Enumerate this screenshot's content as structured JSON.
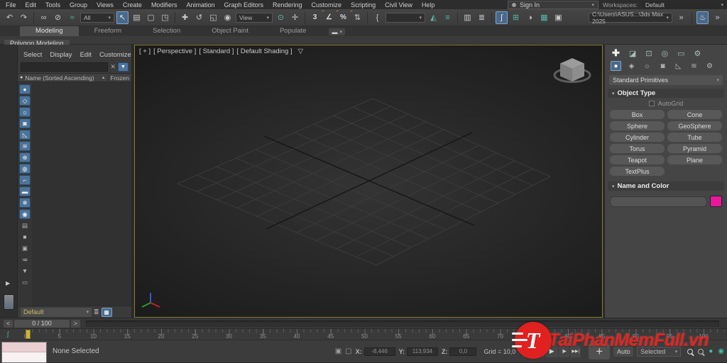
{
  "menubar": {
    "items": [
      "File",
      "Edit",
      "Tools",
      "Group",
      "Views",
      "Create",
      "Modifiers",
      "Animation",
      "Graph Editors",
      "Rendering",
      "Customize",
      "Scripting",
      "Civil View",
      "Help"
    ],
    "sign_in": "Sign In",
    "workspaces_label": "Workspaces:",
    "workspace_value": "Default"
  },
  "toolbar": {
    "selection_filter": "All",
    "coord_system": "View",
    "project_path": "C:\\Users\\ASUS...\\3ds Max 2025"
  },
  "ribbon": {
    "tabs": [
      "Modeling",
      "Freeform",
      "Selection",
      "Object Paint",
      "Populate"
    ],
    "subtab": "Polygon Modeling"
  },
  "explorer": {
    "menu": [
      "Select",
      "Display",
      "Edit",
      "Customize"
    ],
    "column_name": "Name (Sorted Ascending)",
    "column_frozen": "Frozen",
    "footer_value": "Default"
  },
  "viewport": {
    "seg_plus": "[ + ]",
    "seg_pov": "[ Perspective ]",
    "seg_standard": "[ Standard ]",
    "seg_shading": "[ Default Shading ]"
  },
  "command_panel": {
    "dropdown": "Standard Primitives",
    "rollout_object_type": "Object Type",
    "autogrid": "AutoGrid",
    "primitive_buttons": [
      "Box",
      "Cone",
      "Sphere",
      "GeoSphere",
      "Cylinder",
      "Tube",
      "Torus",
      "Pyramid",
      "Teapot",
      "Plane",
      "TextPlus"
    ],
    "rollout_name_color": "Name and Color",
    "swatch_color": "#e8189b",
    "swatch_style": "background:#e8189b"
  },
  "timeline": {
    "frame_display": "0 / 100",
    "start": 0,
    "end": 100,
    "step": 5
  },
  "statusbar": {
    "selection": "None Selected",
    "x_label": "X:",
    "x_value": "-8,446",
    "y_label": "Y:",
    "y_value": "113,934",
    "z_label": "Z:",
    "z_value": "0,0",
    "grid": "Grid = 10,0",
    "auto": "Auto",
    "selected": "Selected"
  },
  "watermark": {
    "text": "TaiPhanMemFull.vn",
    "logo_letter": "T",
    "color": "#e32420",
    "text_style": "color:#e32420"
  },
  "icons": {
    "undo": "↶",
    "redo": "↷",
    "link": "∞",
    "unlink": "⊘",
    "bind_spacewarp": "≈",
    "select": "↖",
    "select_by_name": "▤",
    "selection_region": "▢",
    "window_crossing": "◳",
    "move": "✚",
    "rotate": "↺",
    "scale": "◱",
    "place": "◉",
    "pivot_center": "⊙",
    "manipulate": "✛",
    "snap_3d": "3",
    "snap_angle": "∠",
    "snap_percent": "%",
    "snap_spinner": "⇅",
    "snap_mark": "⌐",
    "named_sets": "{",
    "mirror": "◭",
    "align": "≡",
    "toggle_scene_explorer": "▥",
    "toggle_layer_explorer": "≣",
    "curve_editor": "∫",
    "schematic_view": "⊞",
    "material_editor": "◑",
    "render_setup": "▦",
    "rendered_frame": "▣",
    "render": "♨",
    "expand": "»",
    "dropdown_arrow": "▾",
    "caret": "▾",
    "ribbon_media": "▬",
    "filter_funnel": "▼",
    "clear_x": "✕",
    "sort_asc": "▲",
    "header_dot": "●",
    "exp_geometry": "●",
    "exp_shapes": "◇",
    "exp_lights": "☼",
    "exp_cameras": "◙",
    "exp_helpers": "◺",
    "exp_spacewarps": "≋",
    "exp_groups": "⊕",
    "exp_xrefs": "◍",
    "exp_bones": "⌐",
    "exp_containers": "▬",
    "exp_frozen": "❄",
    "exp_hidden": "◉",
    "exp_list": "▤",
    "exp_box": "■",
    "exp_small": "▣",
    "exp_filter_config": "≔",
    "exp_filter": "▼",
    "exp_folder": "▭",
    "cp_create": "✚",
    "cp_modify": "◪",
    "cp_hierarchy": "⊡",
    "cp_motion": "◎",
    "cp_display": "▭",
    "cp_utilities": "⚙",
    "cat_geometry": "●",
    "cat_shapes": "◈",
    "cat_lights": "☼",
    "cat_cameras": "◙",
    "cat_helpers": "◺",
    "cat_spacewarps": "≋",
    "cat_systems": "⚙",
    "rollout_arrow": "▾",
    "footer_layers": "≣",
    "footer_grid": "▦",
    "tr_start": "|◀◀",
    "tr_prev": "◀|",
    "tr_play": "▶",
    "tr_next": "|▶",
    "tr_end": "▶▶|",
    "key_plus": "+",
    "viewport_funnel": "▽",
    "curve_mini": "∫",
    "slider_prev": "<",
    "slider_next": ">",
    "isolate": "▣",
    "lock": "▢",
    "strip_expand": "▶"
  }
}
